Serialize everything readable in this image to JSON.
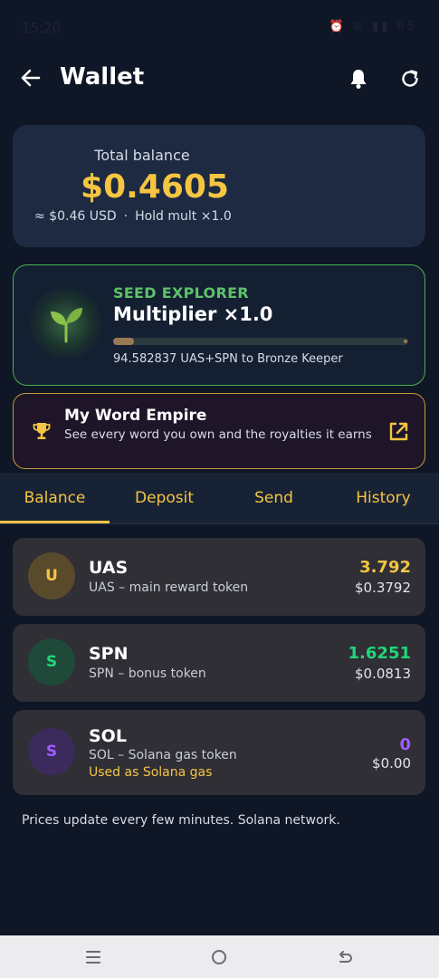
{
  "status_bar": {
    "time": "15:20",
    "battery": "65"
  },
  "header": {
    "title": "Wallet"
  },
  "balance": {
    "label": "Total balance",
    "amount": "$0.4605",
    "usd": "≈ $0.46 USD",
    "separator": "·",
    "hold_mult": "Hold mult ×1.0"
  },
  "tier": {
    "name": "SEED EXPLORER",
    "multiplier": "Multiplier ×1.0",
    "progress_fraction": 0.07,
    "progress_text": "94.582837 UAS+SPN to Bronze Keeper"
  },
  "empire": {
    "title": "My Word Empire",
    "description": "See every word you own and the royalties it earns"
  },
  "tabs": [
    {
      "label": "Balance",
      "active": true
    },
    {
      "label": "Deposit",
      "active": false
    },
    {
      "label": "Send",
      "active": false
    },
    {
      "label": "History",
      "active": false
    }
  ],
  "tokens": [
    {
      "initial": "U",
      "symbol": "UAS",
      "description": "UAS – main reward token",
      "note": "",
      "amount": "3.792",
      "usd": "$0.3792",
      "amount_color": "#f5c542",
      "avatar_bg": "#5a4a2c",
      "avatar_fg": "#f5c542"
    },
    {
      "initial": "S",
      "symbol": "SPN",
      "description": "SPN – bonus token",
      "note": "",
      "amount": "1.6251",
      "usd": "$0.0813",
      "amount_color": "#22d67a",
      "avatar_bg": "#1f4a3a",
      "avatar_fg": "#22d67a"
    },
    {
      "initial": "S",
      "symbol": "SOL",
      "description": "SOL – Solana gas token",
      "note": "Used as Solana gas",
      "amount": "0",
      "usd": "$0.00",
      "amount_color": "#a05cff",
      "avatar_bg": "#3b2a5c",
      "avatar_fg": "#a05cff"
    }
  ],
  "footer": {
    "note": "Prices update every few minutes. Solana network."
  },
  "icons": {
    "back": "arrow-left-icon",
    "bell": "bell-icon",
    "refresh": "refresh-icon",
    "sprout": "sprout-icon",
    "trophy": "trophy-icon",
    "external_link": "external-link-icon"
  },
  "colors": {
    "accent": "#f5c542",
    "tier_green": "#5ec16a",
    "background": "#0f1626"
  }
}
